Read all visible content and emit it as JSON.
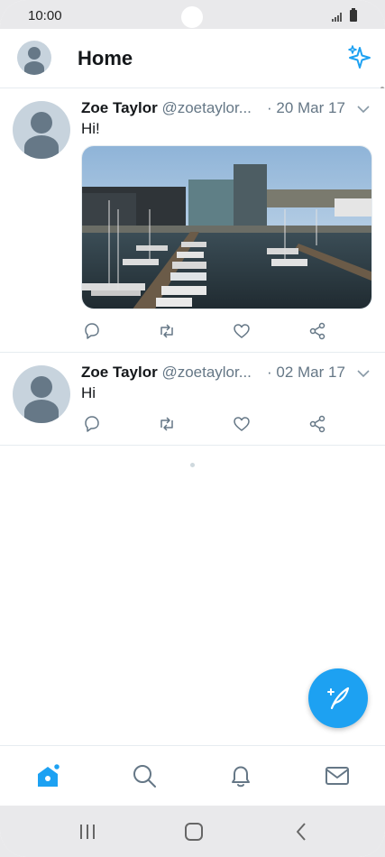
{
  "status_bar": {
    "time": "10:00"
  },
  "header": {
    "title": "Home"
  },
  "tweets": [
    {
      "name": "Zoe Taylor",
      "handle": "@zoetaylor...",
      "date": "· 20 Mar 17",
      "text": "Hi!",
      "has_media": true
    },
    {
      "name": "Zoe Taylor",
      "handle": "@zoetaylor...",
      "date": "· 02 Mar 17",
      "text": "Hi",
      "has_media": false
    }
  ],
  "actions": [
    "reply-icon",
    "retweet-icon",
    "like-icon",
    "share-icon"
  ],
  "tabs": [
    "home-icon",
    "search-icon",
    "notifications-icon",
    "messages-icon"
  ],
  "colors": {
    "accent": "#1da1f2",
    "muted": "#657786"
  }
}
